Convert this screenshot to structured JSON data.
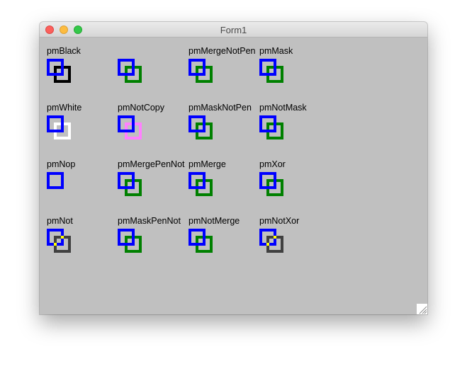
{
  "window": {
    "title": "Form1"
  },
  "pen_color": "#0000ff",
  "cells": [
    {
      "label": "pmBlack",
      "a": "#0000ff",
      "b": "#000000",
      "overlap": null
    },
    {
      "label": "",
      "a": "#0000ff",
      "b": "#008000",
      "overlap": null
    },
    {
      "label": "pmMergeNotPen",
      "a": "#0000ff",
      "b": "#008000",
      "overlap": null
    },
    {
      "label": "pmMask",
      "a": "#0000ff",
      "b": "#008000",
      "overlap": null
    },
    {
      "label": "pmWhite",
      "a": "#0000ff",
      "b": "#ffffff",
      "overlap": null
    },
    {
      "label": "pmNotCopy",
      "a": "#0000ff",
      "b": "#ff80ff",
      "overlap": null
    },
    {
      "label": "pmMaskNotPen",
      "a": "#0000ff",
      "b": "#008000",
      "overlap": null
    },
    {
      "label": "pmNotMask",
      "a": "#0000ff",
      "b": "#008000",
      "overlap": null
    },
    {
      "label": "pmNop",
      "a": "#0000ff",
      "b": null,
      "overlap": null
    },
    {
      "label": "pmMergePenNot",
      "a": "#0000ff",
      "b": "#008000",
      "overlap": null
    },
    {
      "label": "pmMerge",
      "a": "#0000ff",
      "b": "#008000",
      "overlap": null
    },
    {
      "label": "pmXor",
      "a": "#0000ff",
      "b": "#008000",
      "overlap": null
    },
    {
      "label": "pmNot",
      "a": "#0000ff",
      "b": "#404040",
      "overlap": "#ffff00"
    },
    {
      "label": "pmMaskPenNot",
      "a": "#0000ff",
      "b": "#008000",
      "overlap": null
    },
    {
      "label": "pmNotMerge",
      "a": "#0000ff",
      "b": "#008000",
      "overlap": null
    },
    {
      "label": "pmNotXor",
      "a": "#0000ff",
      "b": "#404040",
      "overlap": "#ffff00"
    }
  ]
}
